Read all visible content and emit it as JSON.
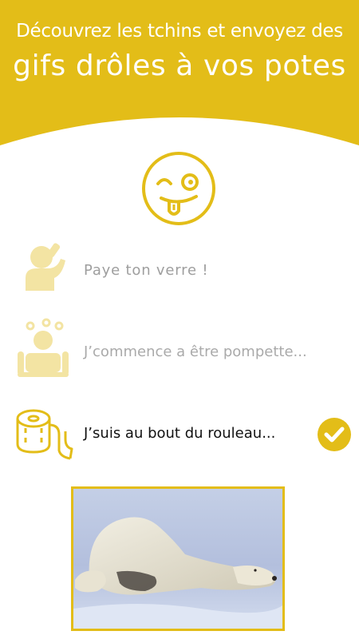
{
  "colors": {
    "brand_yellow": "#e3bd18",
    "icon_yellow": "#f3e4a3",
    "white": "#ffffff"
  },
  "header": {
    "line1": "Découvrez les tchins et envoyez des",
    "line2": "gifs drôles à vos potes"
  },
  "mood_icon": "winking-smiley-tongue-icon",
  "options": [
    {
      "label": "Paye ton verre !",
      "icon": "person-drinking-icon",
      "selected": false
    },
    {
      "label": "J’commence a être pompette...",
      "icon": "tipsy-person-icon",
      "selected": false
    },
    {
      "label": "J’suis au bout du rouleau...",
      "icon": "toilet-paper-roll-icon",
      "selected": true
    }
  ],
  "preview": {
    "icon": "polar-bear-gif"
  }
}
